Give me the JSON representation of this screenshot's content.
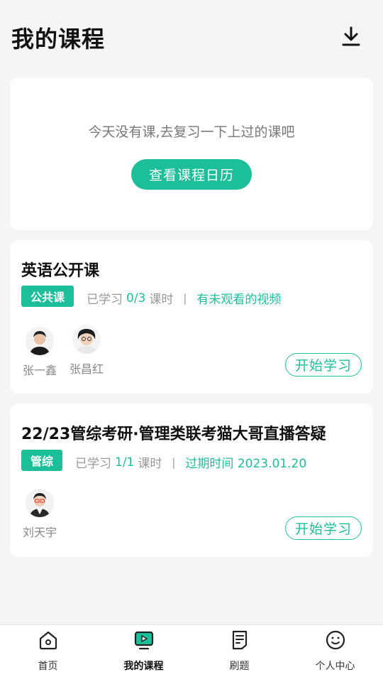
{
  "header": {
    "title": "我的课程",
    "download_icon": "download-icon"
  },
  "empty_card": {
    "message": "今天没有课,去复习一下上过的课吧",
    "calendar_button": "查看课程日历"
  },
  "courses": [
    {
      "title": "英语公开课",
      "tag": "公共课",
      "progress_prefix": "已学习",
      "progress": "0/3",
      "progress_unit": "课时",
      "separator": "|",
      "notice": "有未观看的视频",
      "teachers": [
        "张一鑫",
        "张昌红"
      ],
      "start_button": "开始学习"
    },
    {
      "title": "22/23管综考研·管理类联考猫大哥直播答疑",
      "tag": "管综",
      "progress_prefix": "已学习",
      "progress": "1/1",
      "progress_unit": "课时",
      "separator": "|",
      "notice": "过期时间 2023.01.20",
      "teachers": [
        "刘天宇"
      ],
      "start_button": "开始学习"
    }
  ],
  "tabbar": {
    "items": [
      {
        "label": "首页",
        "icon": "home-icon"
      },
      {
        "label": "我的课程",
        "icon": "video-icon",
        "active": true
      },
      {
        "label": "刷题",
        "icon": "document-icon"
      },
      {
        "label": "个人中心",
        "icon": "smiley-icon"
      }
    ]
  },
  "colors": {
    "accent": "#1dbf9a",
    "background": "#f5f5f5"
  }
}
